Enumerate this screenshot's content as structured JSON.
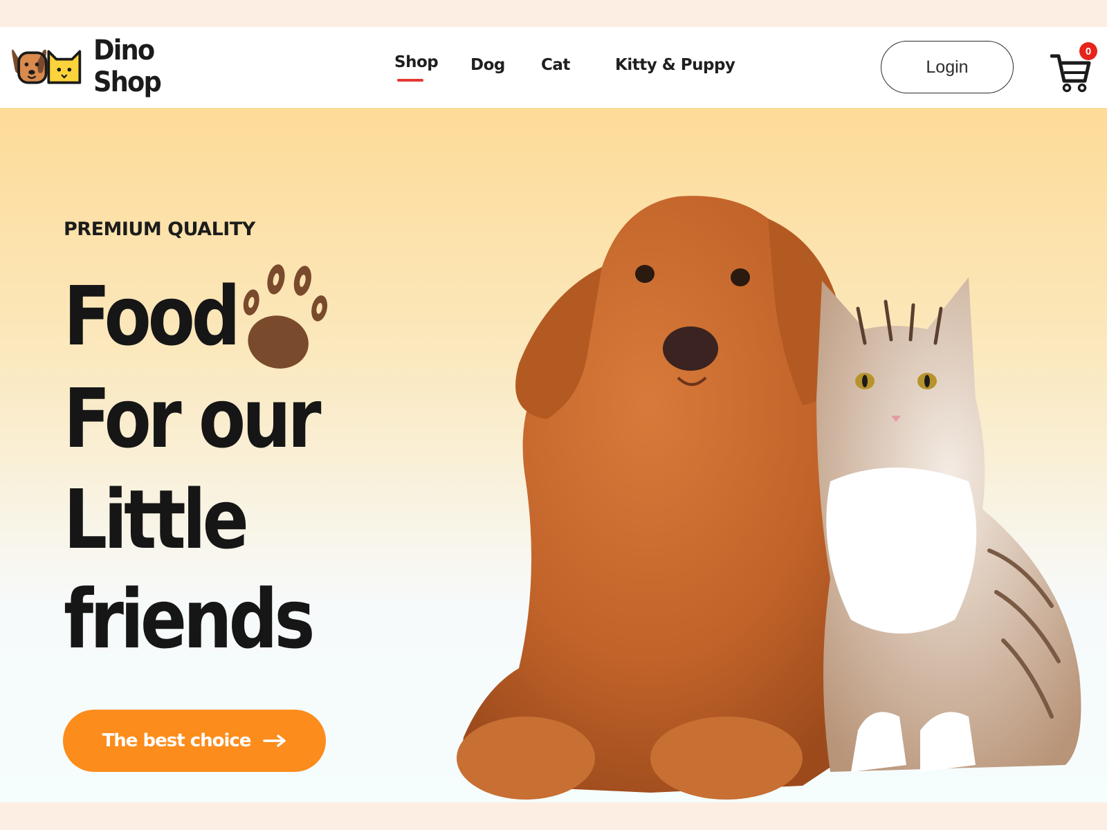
{
  "brand": {
    "name": "Dino Shop",
    "logo_icon": "dog-and-cat-logo-icon"
  },
  "nav": {
    "items": [
      {
        "label": "Shop",
        "active": true
      },
      {
        "label": "Dog",
        "active": false
      },
      {
        "label": "Cat",
        "active": false
      },
      {
        "label": "Kitty & Puppy",
        "active": false
      }
    ],
    "active_color": "#e53935"
  },
  "header": {
    "login_label": "Login",
    "cart_icon": "shopping-cart-icon",
    "cart_count": "0"
  },
  "hero": {
    "eyebrow": "PREMIUM QUALITY",
    "headline": [
      "Food",
      "For our",
      "Little",
      "friends"
    ],
    "paw_icon": "paw-print-icon",
    "cta_label": "The best choice",
    "cta_icon": "arrow-right-icon",
    "image": "golden-retriever-and-tabby-cat-photo"
  },
  "colors": {
    "accent": "#fc8c1c",
    "badge": "#e5241b",
    "text": "#161616",
    "paw": "#7a4a2c"
  }
}
